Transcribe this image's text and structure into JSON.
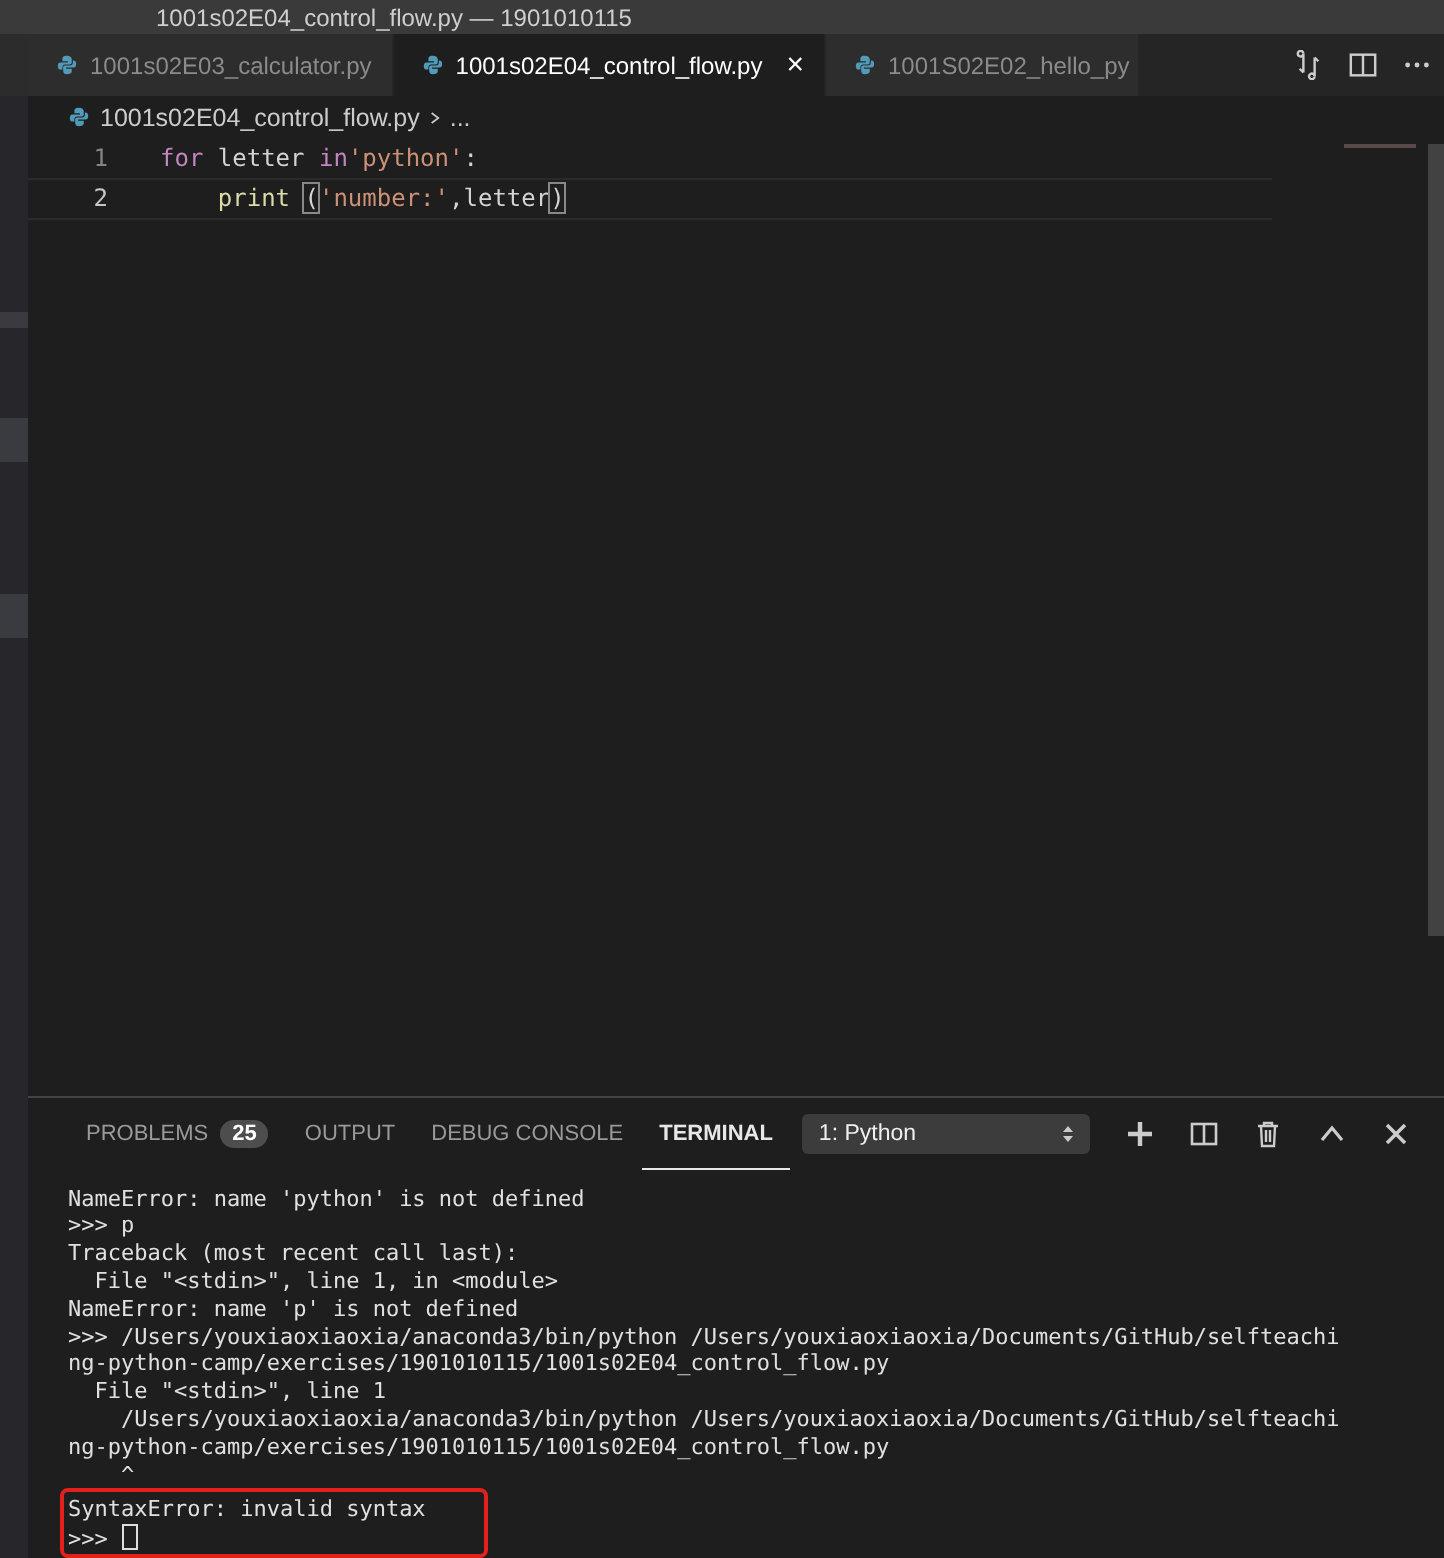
{
  "window": {
    "title": "1001s02E04_control_flow.py — 1901010115"
  },
  "tabs": [
    {
      "label": "1001s02E03_calculator.py",
      "selected": false
    },
    {
      "label": "1001s02E04_control_flow.py",
      "selected": true,
      "close": "×"
    },
    {
      "label": "1001S02E02_hello_py",
      "selected": false
    }
  ],
  "breadcrumb": {
    "file": "1001s02E04_control_flow.py",
    "more": "..."
  },
  "editor": {
    "lines": [
      {
        "number": "1",
        "tokens": [
          {
            "kind": "keyword",
            "text": "for"
          },
          {
            "kind": "plain",
            "text": " letter "
          },
          {
            "kind": "keyword",
            "text": "in"
          },
          {
            "kind": "string",
            "text": "'python'"
          },
          {
            "kind": "plain",
            "text": ":"
          }
        ]
      },
      {
        "number": "2",
        "tokens": [
          {
            "kind": "function",
            "text": "    print "
          },
          {
            "kind": "bracket",
            "text": "("
          },
          {
            "kind": "string",
            "text": "'number:'"
          },
          {
            "kind": "plain",
            "text": ",letter"
          },
          {
            "kind": "bracket",
            "text": ")"
          }
        ]
      }
    ]
  },
  "panel": {
    "tabs": [
      {
        "label": "PROBLEMS",
        "selected": false,
        "badge": "25"
      },
      {
        "label": "OUTPUT",
        "selected": false
      },
      {
        "label": "DEBUG CONSOLE",
        "selected": false
      },
      {
        "label": "TERMINAL",
        "selected": true
      }
    ],
    "terminal_select": "1: Python",
    "terminal": {
      "lines": [
        "NameError: name 'python' is not defined",
        ">>> p",
        "Traceback (most recent call last):",
        "  File \"<stdin>\", line 1, in <module>",
        "NameError: name 'p' is not defined",
        ">>> /Users/youxiaoxiaoxia/anaconda3/bin/python /Users/youxiaoxiaoxia/Documents/GitHub/selfteachi",
        "ng-python-camp/exercises/1901010115/1001s02E04_control_flow.py",
        "  File \"<stdin>\", line 1",
        "    /Users/youxiaoxiaoxia/anaconda3/bin/python /Users/youxiaoxiaoxia/Documents/GitHub/selfteachi",
        "ng-python-camp/exercises/1901010115/1001s02E04_control_flow.py",
        "    ^"
      ],
      "highlighted_lines": [
        "SyntaxError: invalid syntax",
        ">>> "
      ]
    }
  }
}
